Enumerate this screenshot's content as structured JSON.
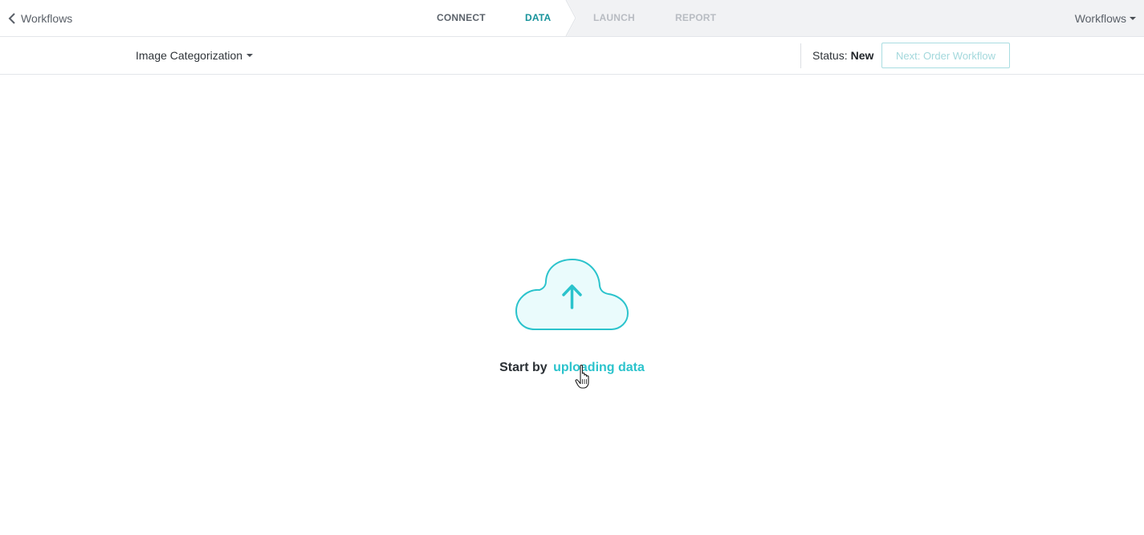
{
  "nav": {
    "back_label": "Workflows",
    "steps": [
      {
        "label": "CONNECT",
        "state": "done"
      },
      {
        "label": "DATA",
        "state": "active"
      },
      {
        "label": "LAUNCH",
        "state": "disabled"
      },
      {
        "label": "REPORT",
        "state": "disabled"
      }
    ],
    "menu_label": "Workflows"
  },
  "toolbar": {
    "project_name": "Image Categorization",
    "status_label": "Status:",
    "status_value": "New",
    "next_button_label": "Next: Order Workflow"
  },
  "empty_state": {
    "icon": "cloud-upload-icon",
    "prefix": "Start by",
    "link_label": "uploading data"
  },
  "colors": {
    "accent": "#2bc3cc",
    "active_step": "#17939b",
    "disabled_step": "#b8bcc2",
    "cloud_fill": "#eafbfc"
  }
}
